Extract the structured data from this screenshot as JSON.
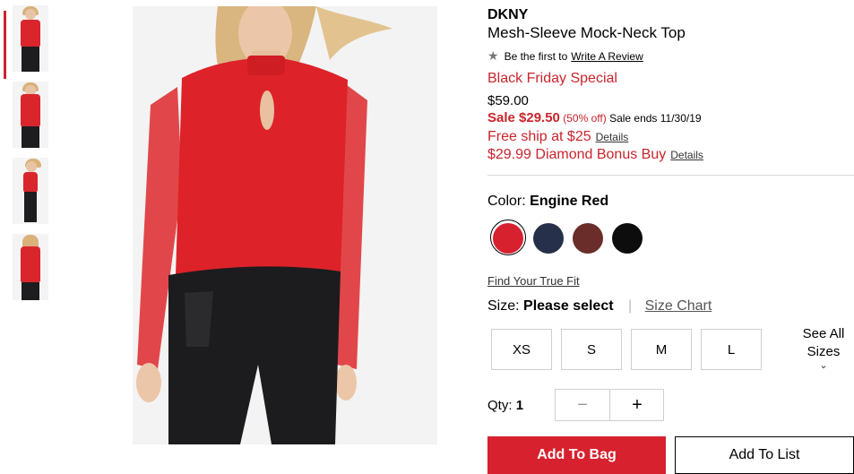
{
  "thumbnails": [
    {
      "name": "front-view"
    },
    {
      "name": "front-close-view"
    },
    {
      "name": "side-view"
    },
    {
      "name": "back-view"
    }
  ],
  "product": {
    "brand": "DKNY",
    "name": "Mesh-Sleeve Mock-Neck Top",
    "review_prefix": "Be the first to",
    "review_link": "Write A Review",
    "special": "Black Friday Special",
    "original_price": "$59.00",
    "sale_label": "Sale $29.50",
    "sale_percent": "(50% off)",
    "sale_ends": "Sale ends 11/30/19",
    "free_ship": "Free ship at $25",
    "free_ship_details": "Details",
    "bonus": "$29.99 Diamond Bonus Buy",
    "bonus_details": "Details"
  },
  "color": {
    "label": "Color:",
    "selected": "Engine Red",
    "swatches": [
      {
        "name": "engine-red",
        "hex": "#d7212e"
      },
      {
        "name": "navy",
        "hex": "#27304a"
      },
      {
        "name": "burgundy",
        "hex": "#6a2d2a"
      },
      {
        "name": "black",
        "hex": "#0d0d0d"
      }
    ]
  },
  "size": {
    "true_fit": "Find Your True Fit",
    "label": "Size:",
    "selected": "Please select",
    "separator": "|",
    "chart": "Size Chart",
    "options": [
      "XS",
      "S",
      "M",
      "L"
    ],
    "see_all_line1": "See All",
    "see_all_line2": "Sizes"
  },
  "qty": {
    "label": "Qty:",
    "value": "1",
    "minus": "−",
    "plus": "+"
  },
  "actions": {
    "add_to_bag": "Add To Bag",
    "add_to_list": "Add To List"
  },
  "colors": {
    "accent_red": "#c9252c",
    "button_red": "#d7212e"
  }
}
